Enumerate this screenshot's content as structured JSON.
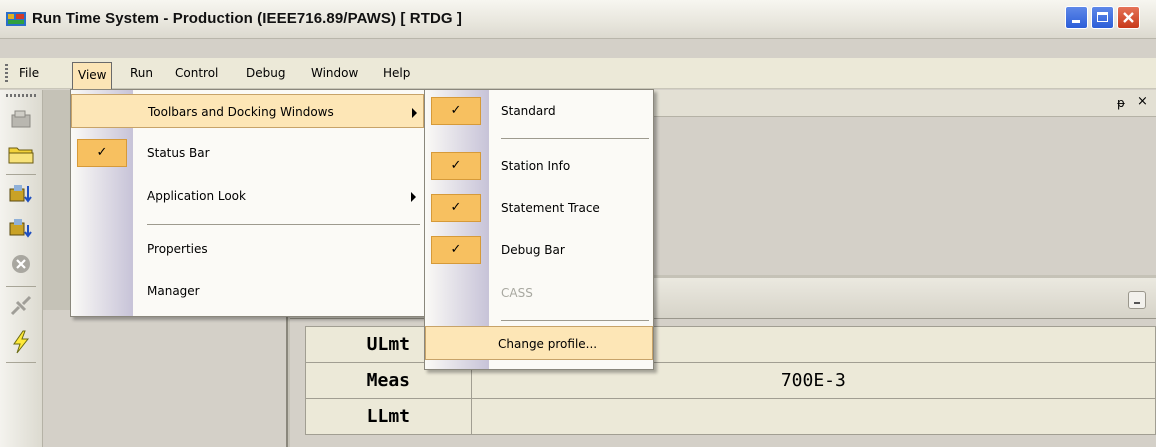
{
  "window": {
    "title": "Run Time System - Production (IEEE716.89/PAWS)   [ RTDG ]"
  },
  "menubar": {
    "items": [
      "File",
      "View",
      "Run",
      "Control",
      "Debug",
      "Window",
      "Help"
    ]
  },
  "view_menu": {
    "items": [
      {
        "label": "Toolbars and Docking Windows",
        "checked": false,
        "submenu": true,
        "highlighted": true
      },
      {
        "label": "Status Bar",
        "checked": true,
        "submenu": false
      },
      {
        "label": "Application Look",
        "checked": false,
        "submenu": true
      },
      {
        "label": "Properties",
        "checked": false,
        "submenu": false
      },
      {
        "label": "Manager",
        "checked": false,
        "submenu": false
      }
    ]
  },
  "toolbars_submenu": {
    "items": [
      {
        "label": "Standard",
        "checked": true
      },
      {
        "label": "Station Info",
        "checked": true
      },
      {
        "label": "Statement Trace",
        "checked": true
      },
      {
        "label": "Debug Bar",
        "checked": true
      },
      {
        "label": "CASS",
        "checked": false,
        "disabled": true
      },
      {
        "label": "Change profile...",
        "checked": false,
        "highlighted": true
      }
    ]
  },
  "check_mark": "✓",
  "dock": {
    "pin_icon": "pin-icon",
    "close_symbol": "×"
  },
  "measurement_table": {
    "rows": [
      {
        "label": "ULmt",
        "value": ""
      },
      {
        "label": "Meas",
        "value": "700E-3"
      },
      {
        "label": "LLmt",
        "value": ""
      }
    ]
  },
  "colors": {
    "highlight": "#fde6b6",
    "check_bg": "#f7c060",
    "close_button": "#c8391b"
  }
}
